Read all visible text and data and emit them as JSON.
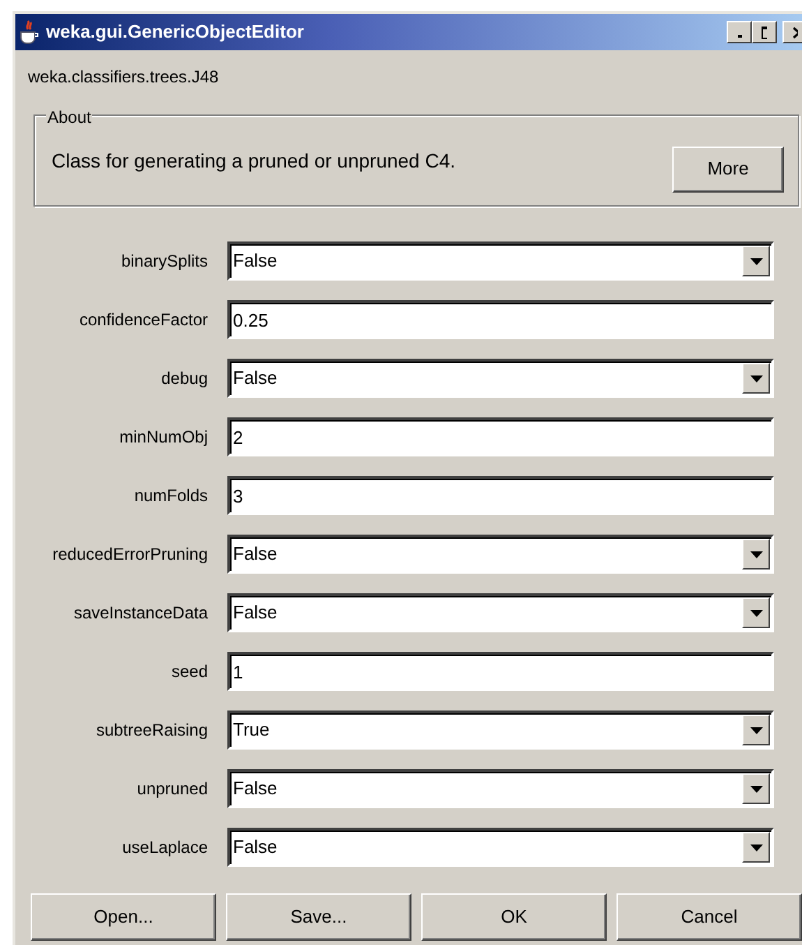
{
  "window": {
    "title": "weka.gui.GenericObjectEditor"
  },
  "class_name": "weka.classifiers.trees.J48",
  "about": {
    "legend": "About",
    "text": "Class for generating a pruned or unpruned C4.",
    "button": "More"
  },
  "properties": [
    {
      "label": "binarySplits",
      "kind": "dropdown",
      "value": "False"
    },
    {
      "label": "confidenceFactor",
      "kind": "text",
      "value": "0.25"
    },
    {
      "label": "debug",
      "kind": "dropdown",
      "value": "False"
    },
    {
      "label": "minNumObj",
      "kind": "text",
      "value": "2"
    },
    {
      "label": "numFolds",
      "kind": "text",
      "value": "3"
    },
    {
      "label": "reducedErrorPruning",
      "kind": "dropdown",
      "value": "False"
    },
    {
      "label": "saveInstanceData",
      "kind": "dropdown",
      "value": "False"
    },
    {
      "label": "seed",
      "kind": "text",
      "value": "1"
    },
    {
      "label": "subtreeRaising",
      "kind": "dropdown",
      "value": "True"
    },
    {
      "label": "unpruned",
      "kind": "dropdown",
      "value": "False"
    },
    {
      "label": "useLaplace",
      "kind": "dropdown",
      "value": "False"
    }
  ],
  "buttons": [
    "Open...",
    "Save...",
    "OK",
    "Cancel"
  ]
}
